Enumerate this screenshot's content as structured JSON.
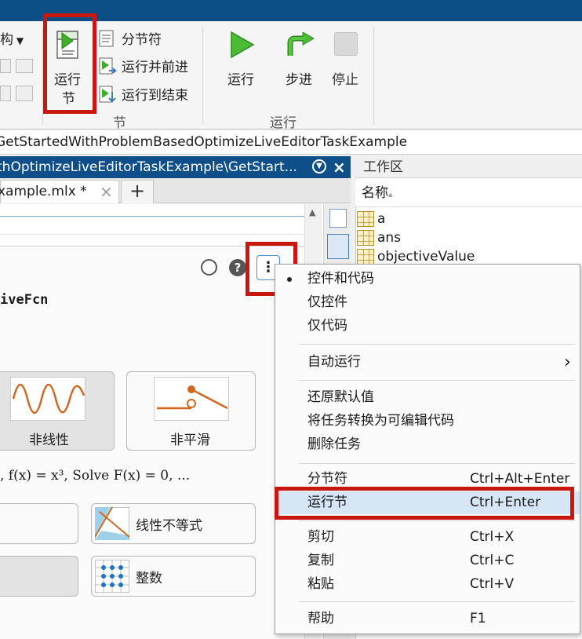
{
  "toolstrip": {
    "left_partial_label": "构",
    "run_section_button": {
      "line1": "运行",
      "line2": "节"
    },
    "section_break": "分节符",
    "run_and_advance": "运行并前进",
    "run_to_end": "运行到结束",
    "section_group_label": "节",
    "run": "运行",
    "step": "步进",
    "stop": "停止",
    "run_group_label": "运行"
  },
  "path": "GetStartedWithProblemBasedOptimizeLiveEditorTaskExample",
  "editor": {
    "title": "thOptimizeLiveEditorTaskExample\\GetStart...",
    "tab_name": "xample.mlx *",
    "task_fn": "iveFcn",
    "task_types": [
      {
        "label": "非线性"
      },
      {
        "label": "非平滑"
      }
    ],
    "formula_text": ", f(x) = x³, Solve F(x) = 0, ...",
    "constraint_types": [
      {
        "label": "线性不等式"
      },
      {
        "label": "整数"
      }
    ]
  },
  "workspace": {
    "title": "工作区",
    "column_name": "名称",
    "sort_indicator": "▴",
    "variables": [
      "a",
      "ans",
      "objectiveValue"
    ]
  },
  "context_menu": {
    "items": [
      {
        "label": "控件和代码",
        "shortcut": "",
        "checked": true
      },
      {
        "label": "仅控件",
        "shortcut": ""
      },
      {
        "label": "仅代码",
        "shortcut": ""
      },
      {
        "label": "自动运行",
        "shortcut": "",
        "submenu": true
      },
      {
        "label": "还原默认值",
        "shortcut": ""
      },
      {
        "label": "将任务转换为可编辑代码",
        "shortcut": ""
      },
      {
        "label": "删除任务",
        "shortcut": ""
      },
      {
        "label": "分节符",
        "shortcut": "Ctrl+Alt+Enter"
      },
      {
        "label": "运行节",
        "shortcut": "Ctrl+Enter",
        "highlighted": true
      },
      {
        "label": "剪切",
        "shortcut": "Ctrl+X"
      },
      {
        "label": "复制",
        "shortcut": "Ctrl+C"
      },
      {
        "label": "粘贴",
        "shortcut": "Ctrl+V"
      },
      {
        "label": "帮助",
        "shortcut": "F1"
      }
    ],
    "submenu_arrow": "›"
  },
  "colors": {
    "title_blue": "#0c4f87",
    "highlight_red": "#c7170f",
    "menu_highlight": "#d6e6f5",
    "run_green": "#3fae2a"
  }
}
